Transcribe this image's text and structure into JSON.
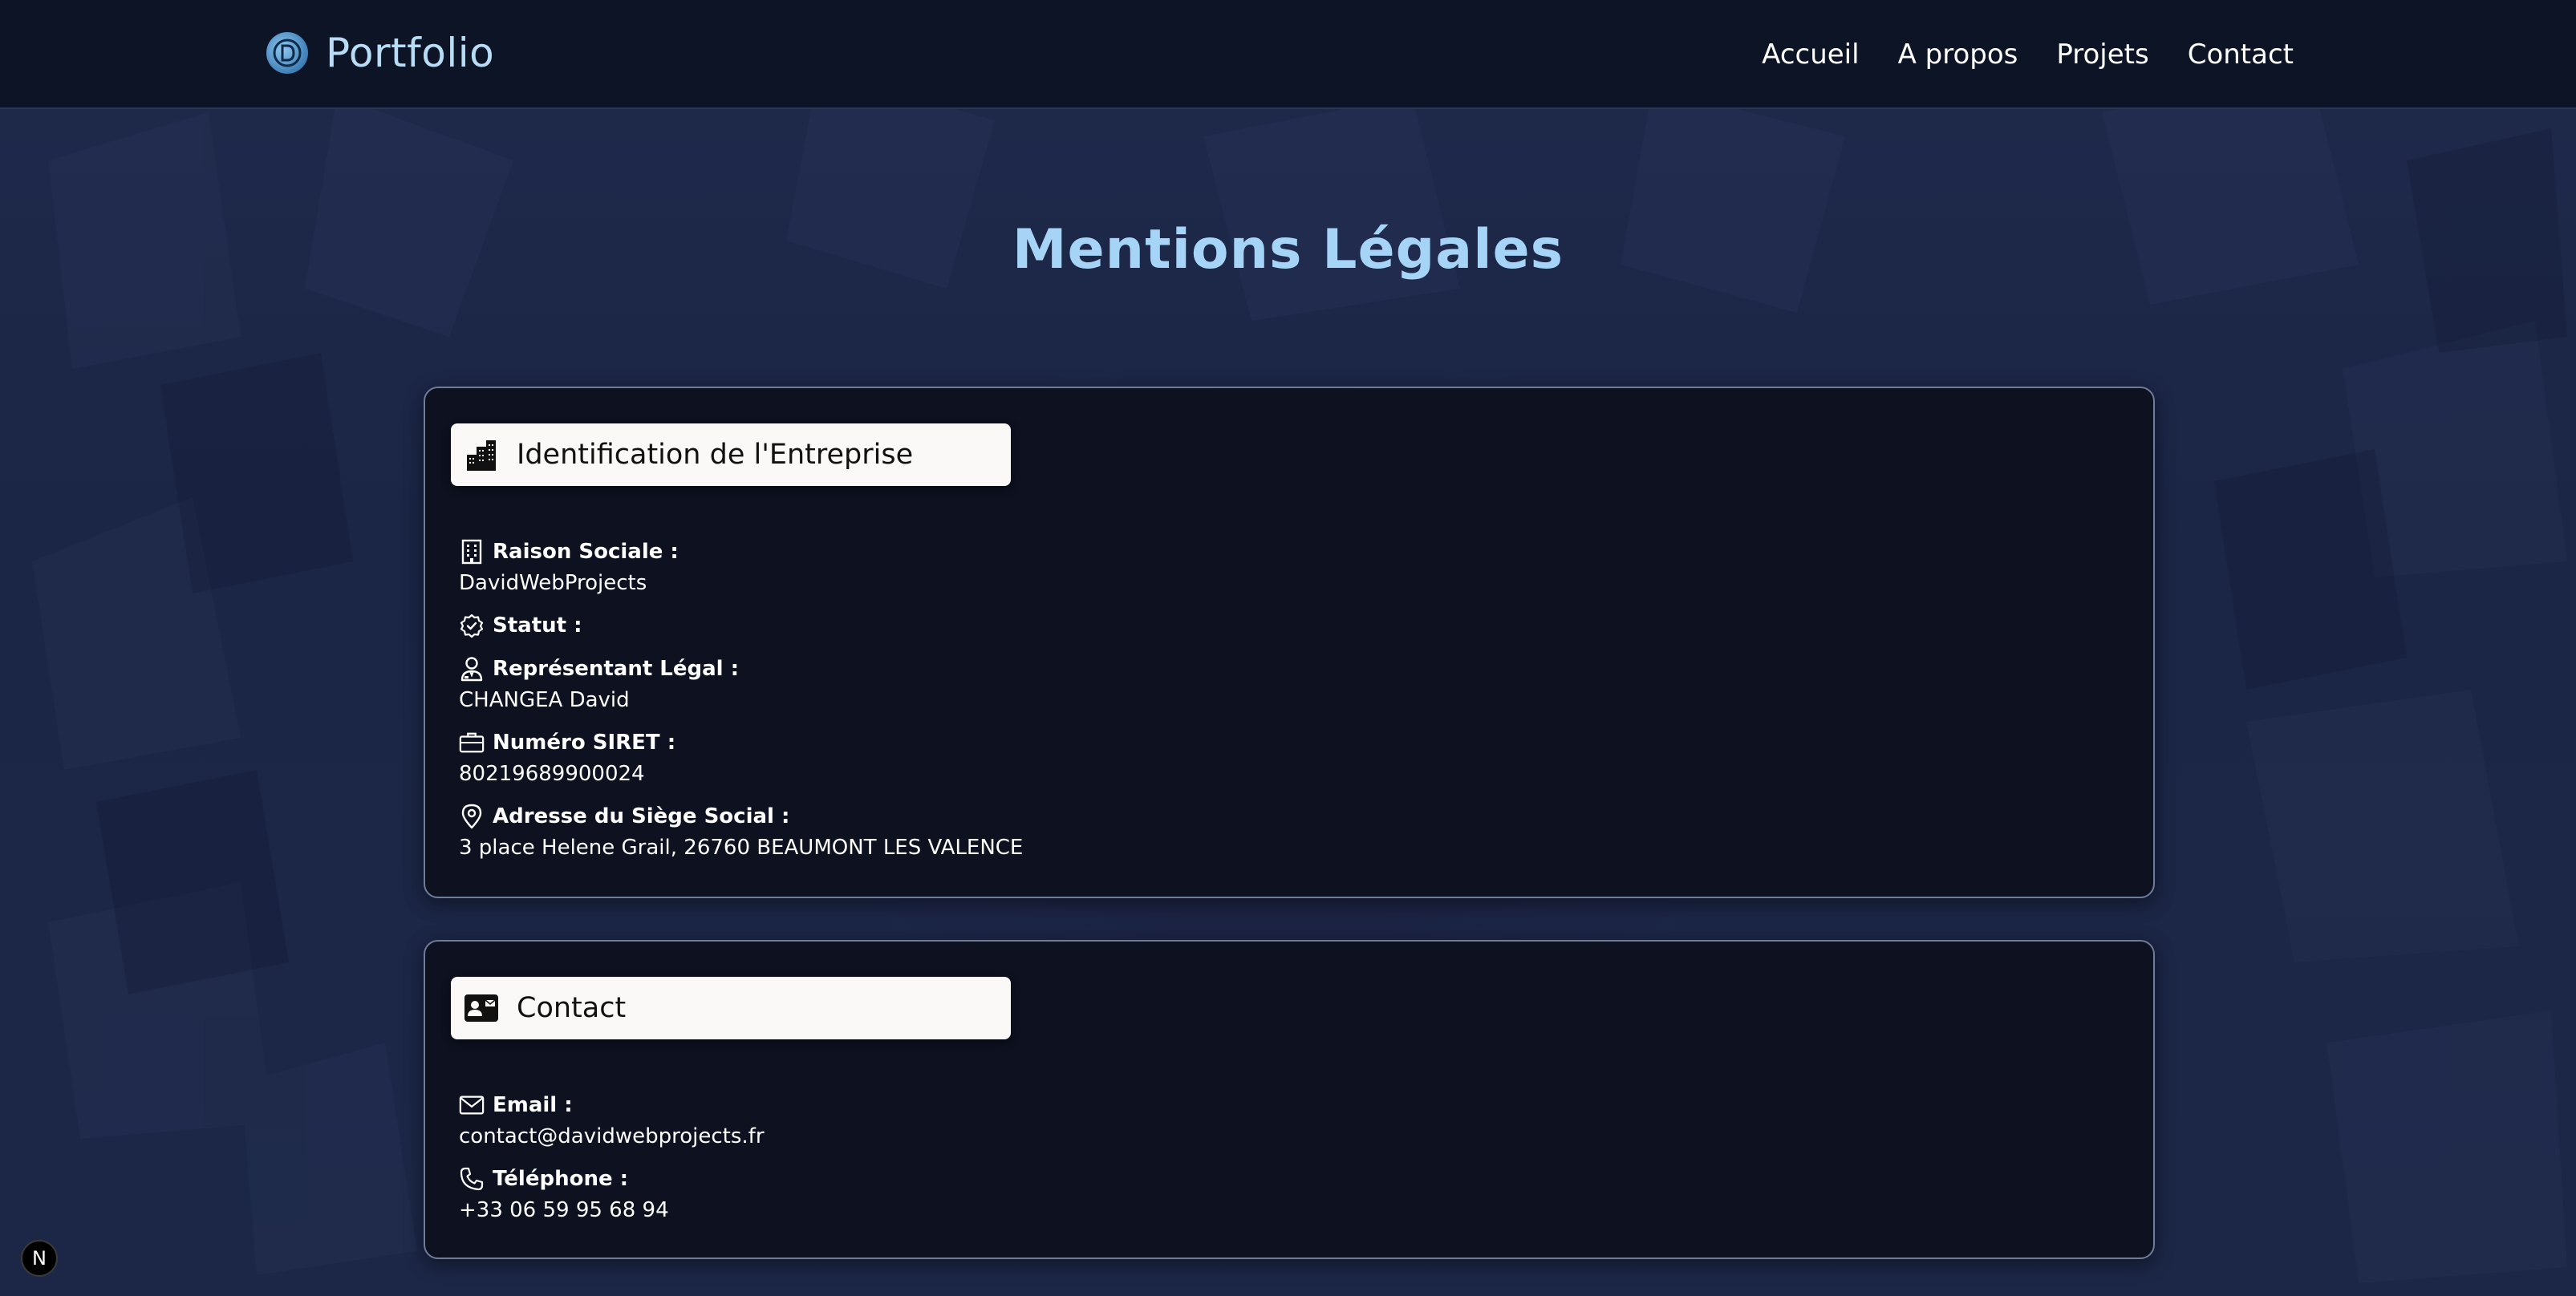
{
  "header": {
    "brand": "Portfolio",
    "nav": [
      "Accueil",
      "A propos",
      "Projets",
      "Contact"
    ]
  },
  "page": {
    "title": "Mentions Légales"
  },
  "identification": {
    "title": "Identification de l'Entreprise",
    "fields": [
      {
        "label": "Raison Sociale :",
        "value": "DavidWebProjects",
        "icon": "building-icon"
      },
      {
        "label": "Statut :",
        "value": "",
        "icon": "badge-check-icon"
      },
      {
        "label": "Représentant Légal :",
        "value": "CHANGEA David",
        "icon": "user-tie-icon"
      },
      {
        "label": "Numéro SIRET :",
        "value": "80219689900024",
        "icon": "briefcase-icon"
      },
      {
        "label": "Adresse du Siège Social :",
        "value": "3 place Helene Grail, 26760 BEAUMONT LES VALENCE",
        "icon": "map-pin-icon"
      }
    ]
  },
  "contact": {
    "title": "Contact",
    "fields": [
      {
        "label": "Email :",
        "value": "contact@davidwebprojects.fr",
        "icon": "mail-icon"
      },
      {
        "label": "Téléphone :",
        "value": "+33 06 59 95 68 94",
        "icon": "phone-icon"
      }
    ]
  },
  "dev_badge": "N",
  "colors": {
    "header_bg": "#0c1426",
    "title": "#a5d4f6",
    "brand": "#b8dcf5",
    "card_bg": "#0d101e",
    "card_border": "#6f7c98",
    "page_bg": "#1c2746"
  }
}
